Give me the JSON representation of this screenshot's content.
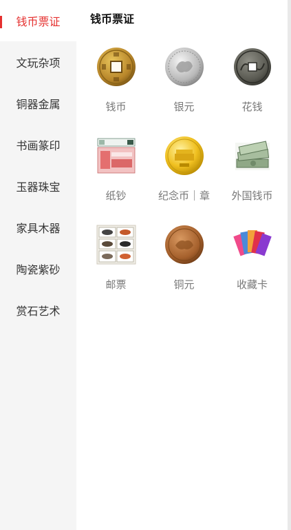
{
  "sidebar": {
    "items": [
      {
        "label": "钱币票证",
        "active": true
      },
      {
        "label": "文玩杂项",
        "active": false
      },
      {
        "label": "铜器金属",
        "active": false
      },
      {
        "label": "书画篆印",
        "active": false
      },
      {
        "label": "玉器珠宝",
        "active": false
      },
      {
        "label": "家具木器",
        "active": false
      },
      {
        "label": "陶瓷紫砂",
        "active": false
      },
      {
        "label": "赏石艺术",
        "active": false
      }
    ]
  },
  "main": {
    "title": "钱币票证",
    "categories": [
      {
        "label": "钱币",
        "icon": "copper-cash-coin-icon"
      },
      {
        "label": "银元",
        "icon": "silver-dollar-icon"
      },
      {
        "label": "花钱",
        "icon": "charm-coin-icon"
      },
      {
        "label": "纸钞",
        "icon": "banknote-icon"
      },
      {
        "label": "纪念币｜章",
        "icon": "gold-commemorative-coin-icon"
      },
      {
        "label": "外国钱币",
        "icon": "foreign-currency-stack-icon"
      },
      {
        "label": "邮票",
        "icon": "stamp-sheet-icon"
      },
      {
        "label": "铜元",
        "icon": "copper-coin-icon"
      },
      {
        "label": "收藏卡",
        "icon": "collectible-cards-icon"
      }
    ]
  },
  "colors": {
    "accent": "#e5302f",
    "sidebar_bg": "#f5f5f5",
    "label_gray": "#777777"
  }
}
